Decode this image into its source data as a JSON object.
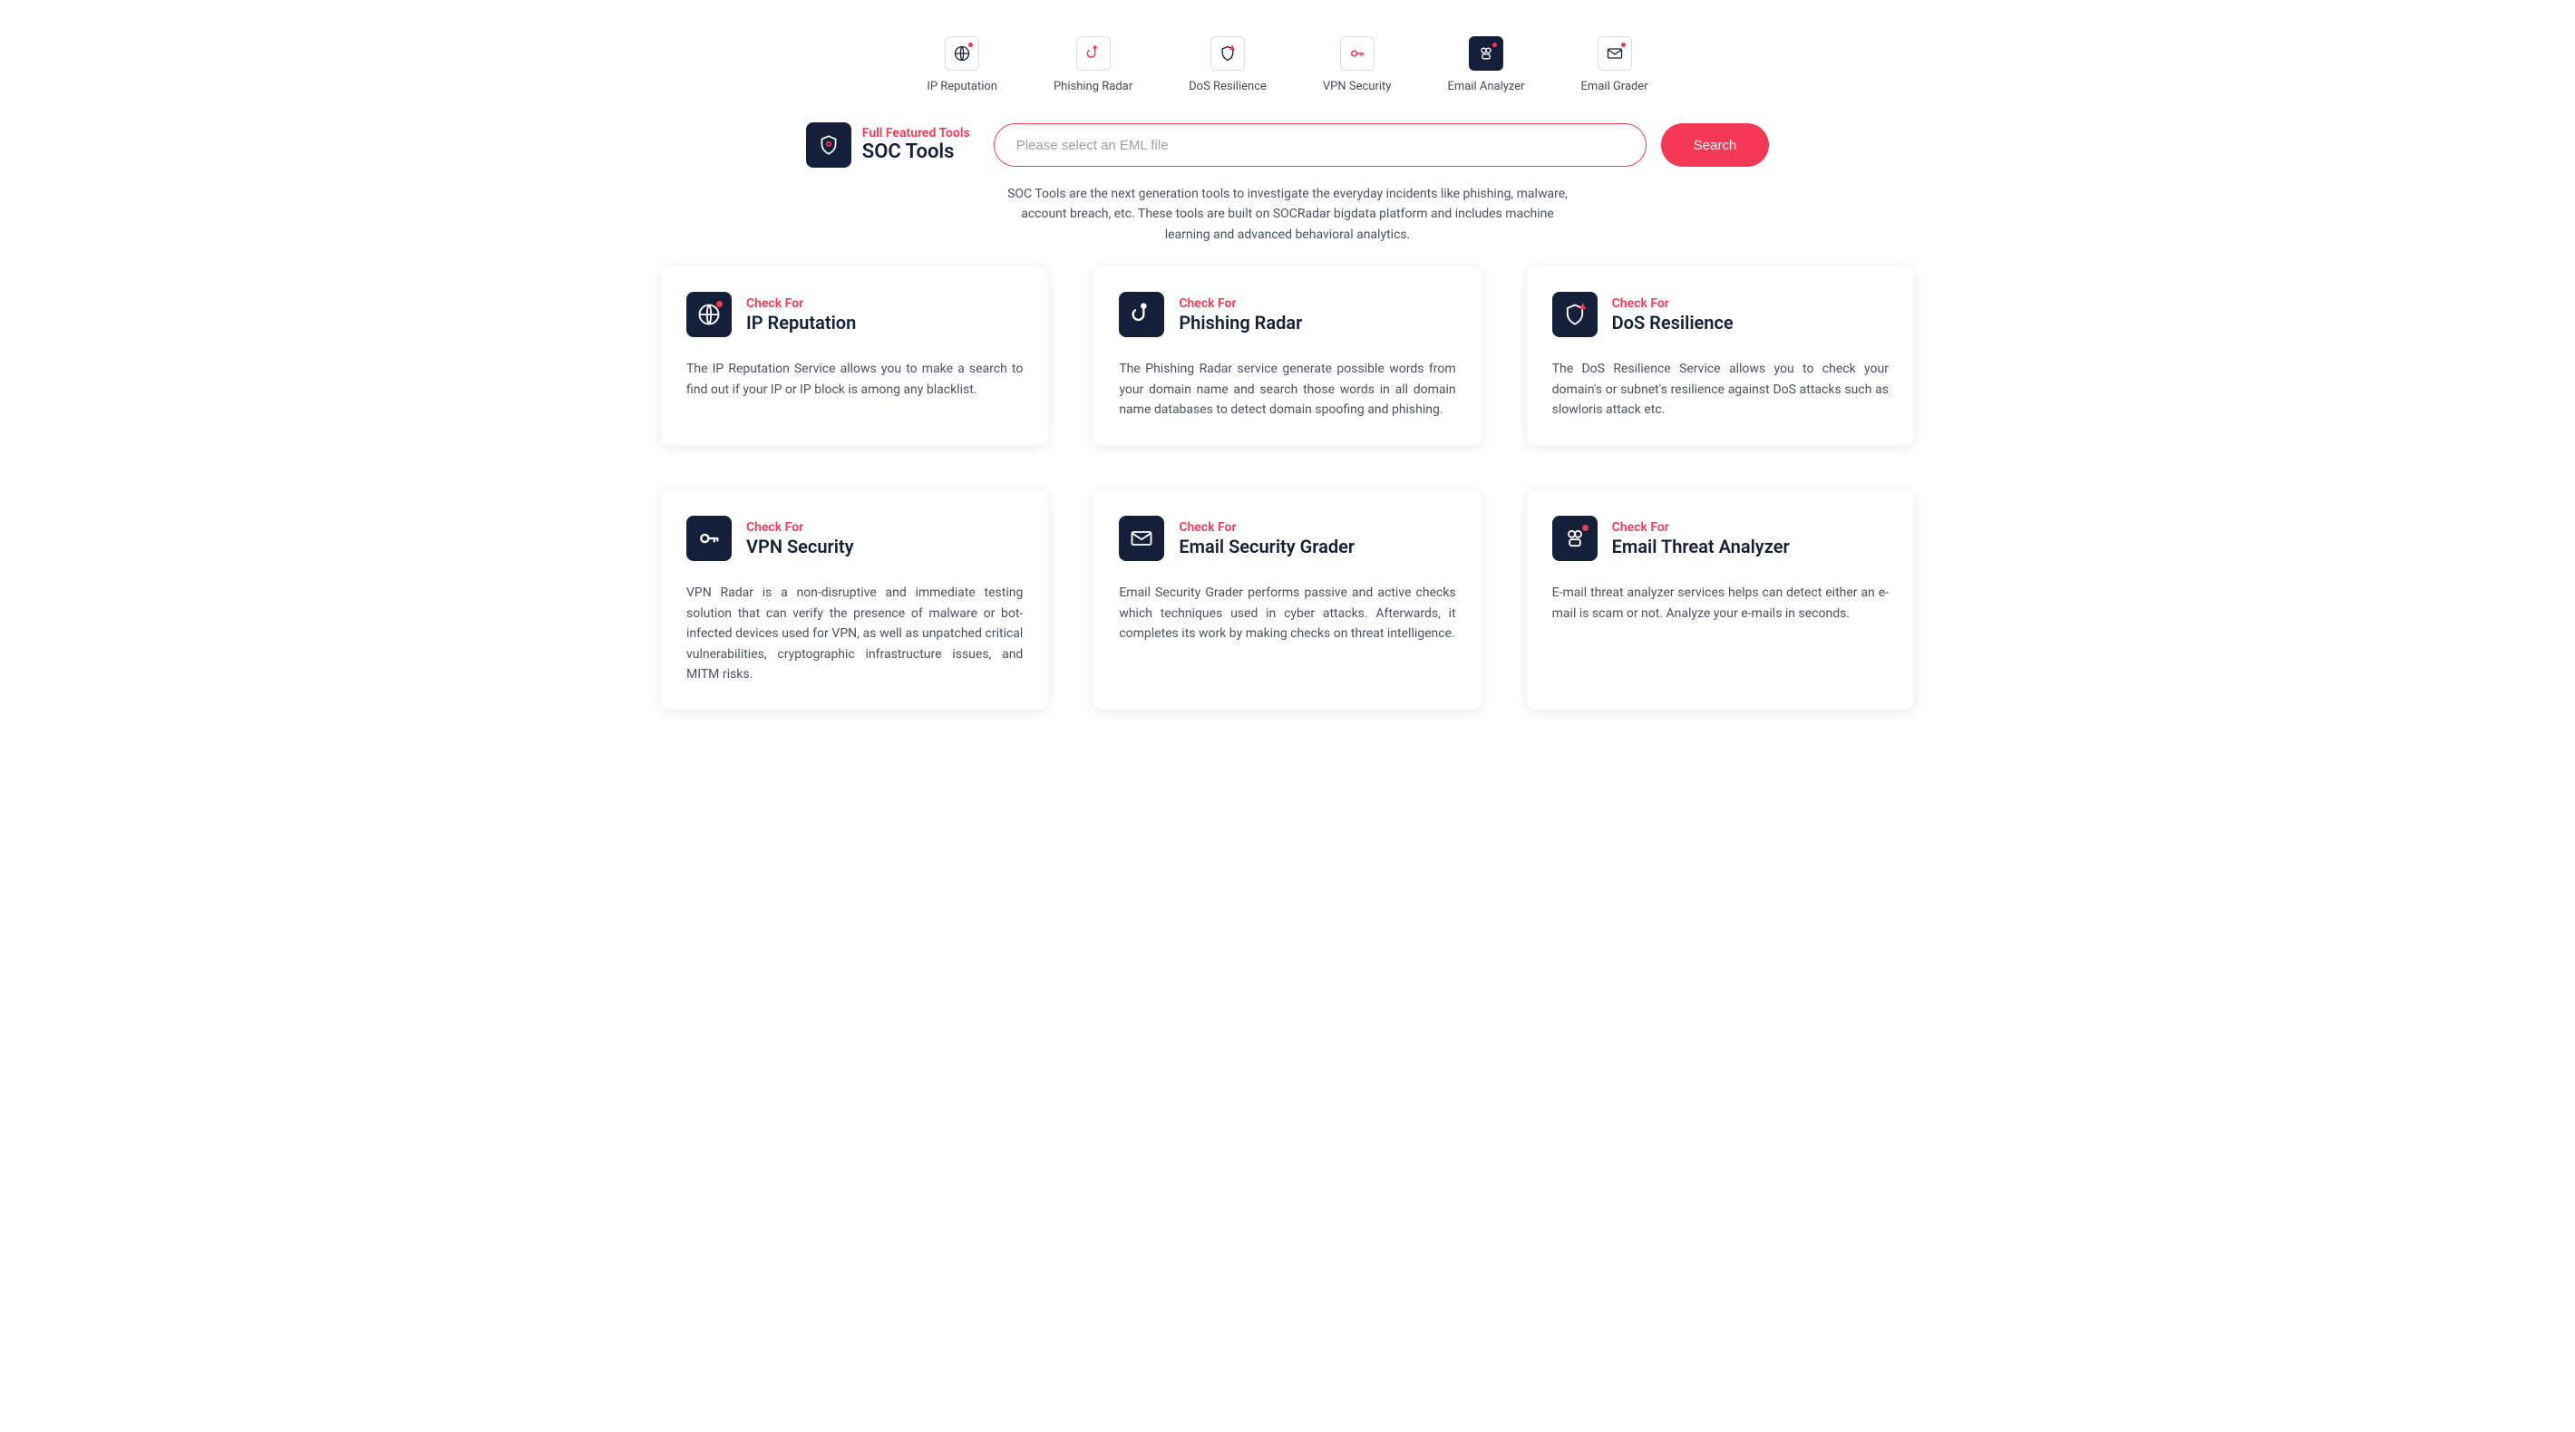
{
  "tabs": [
    {
      "id": "ip-reputation",
      "label": "IP Reputation",
      "active": false
    },
    {
      "id": "phishing-radar",
      "label": "Phishing Radar",
      "active": false
    },
    {
      "id": "dos-resilience",
      "label": "DoS Resilience",
      "active": false
    },
    {
      "id": "vpn-security",
      "label": "VPN Security",
      "active": false
    },
    {
      "id": "email-analyzer",
      "label": "Email Analyzer",
      "active": true
    },
    {
      "id": "email-grader",
      "label": "Email Grader",
      "active": false
    }
  ],
  "brand": {
    "overline": "Full Featured Tools",
    "title": "SOC Tools"
  },
  "search": {
    "placeholder": "Please select an EML file",
    "button": "Search"
  },
  "blurb": "SOC Tools are the next generation tools to investigate the everyday incidents like phishing, malware, account breach, etc. These tools are built on SOCRadar bigdata platform and includes machine learning and advanced behavioral analytics.",
  "cards": [
    {
      "overline": "Check For",
      "title": "IP Reputation",
      "desc": "The IP Reputation Service allows you to make a search to find out if your IP or IP block is among any blacklist.",
      "icon": "globe"
    },
    {
      "overline": "Check For",
      "title": "Phishing Radar",
      "desc": "The Phishing Radar service generate possible words from your domain name and search those words in all domain name databases to detect domain spoofing and phishing.",
      "icon": "hook"
    },
    {
      "overline": "Check For",
      "title": "DoS Resilience",
      "desc": "The DoS Resilience Service allows you to check your domain's or subnet's resilience against DoS attacks such as slowloris attack etc.",
      "icon": "shield"
    },
    {
      "overline": "Check For",
      "title": "VPN Security",
      "desc": "VPN Radar is a non-disruptive and immediate testing solution that can verify the presence of malware or bot-infected devices used for VPN, as well as unpatched critical vulnerabilities, cryptographic infrastructure issues, and MITM risks.",
      "icon": "key"
    },
    {
      "overline": "Check For",
      "title": "Email Security Grader",
      "desc": "Email Security Grader performs passive and active checks which techniques used in cyber attacks. Afterwards, it completes its work by making checks on threat intelligence.",
      "icon": "envelope"
    },
    {
      "overline": "Check For",
      "title": "Email Threat Analyzer",
      "desc": "E-mail threat analyzer services helps can detect either an e-mail is scam or not. Analyze your e-mails in seconds.",
      "icon": "robot"
    }
  ],
  "colors": {
    "accent": "#f53855",
    "dark": "#141f39"
  }
}
